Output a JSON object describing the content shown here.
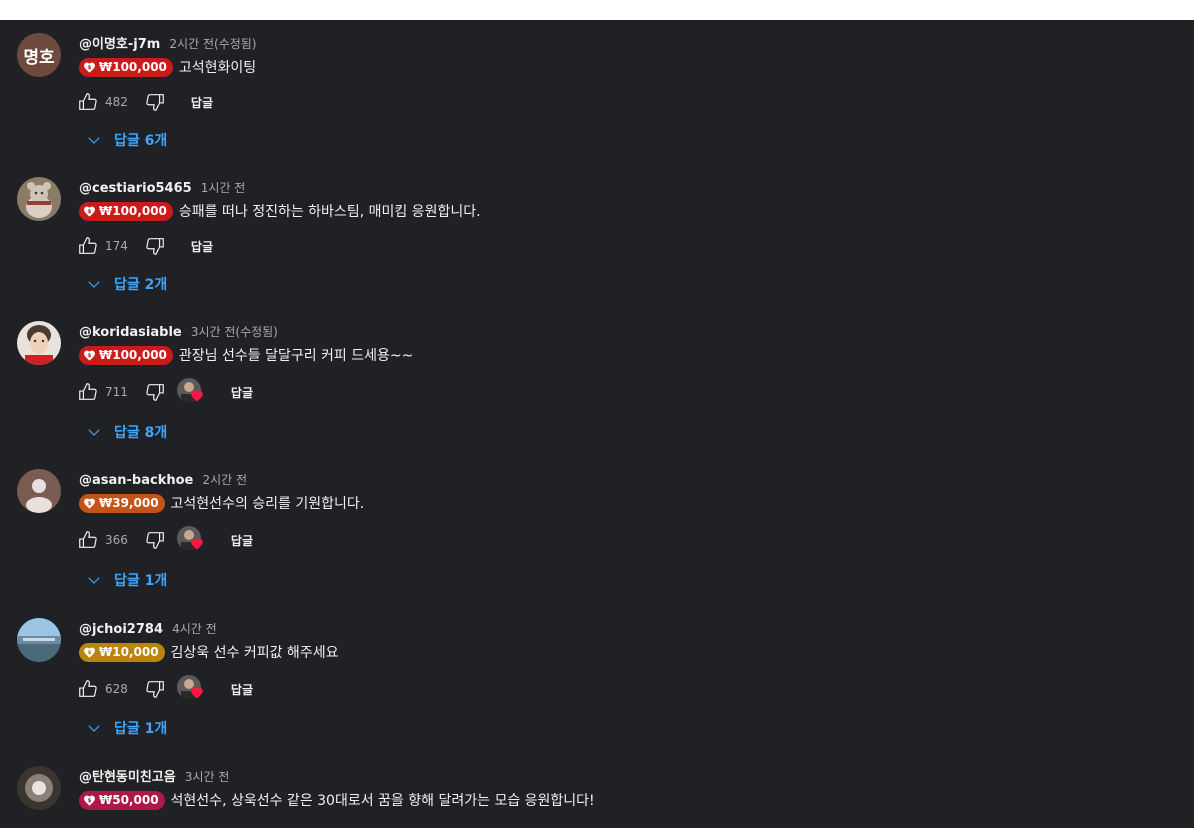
{
  "colors": {
    "background": "#202124",
    "text_primary": "#f1f1f1",
    "text_secondary": "#aaaaaa",
    "link_blue": "#3ea6ff",
    "heart_red": "#ff1744"
  },
  "icons": {
    "like": "thumbs-up-icon",
    "dislike": "thumbs-down-icon",
    "expand": "chevron-down-icon",
    "super_thanks": "money-heart-icon",
    "creator_heart": "heart-icon"
  },
  "comments": [
    {
      "author": "@이명호-j7m",
      "time": "2시간 전(수정됨)",
      "avatar_text": "명호",
      "amount": "₩100,000",
      "amount_color": "#cc1a1a",
      "text": "고석현화이팅",
      "likes": "482",
      "hearted": false,
      "reply_label": "답글",
      "replies_label": "답글 6개"
    },
    {
      "author": "@cestiario5465",
      "time": "1시간 전",
      "avatar_text": "",
      "amount": "₩100,000",
      "amount_color": "#cc1a1a",
      "text": "승패를 떠나 정진하는 하바스팀, 매미킴 응원합니다.",
      "likes": "174",
      "hearted": false,
      "reply_label": "답글",
      "replies_label": "답글 2개"
    },
    {
      "author": "@koridasiable",
      "time": "3시간 전(수정됨)",
      "avatar_text": "",
      "amount": "₩100,000",
      "amount_color": "#cc1a1a",
      "text": "관장님 선수들 달달구리 커피 드세용~~",
      "likes": "711",
      "hearted": true,
      "reply_label": "답글",
      "replies_label": "답글 8개"
    },
    {
      "author": "@asan-backhoe",
      "time": "2시간 전",
      "avatar_text": "",
      "amount": "₩39,000",
      "amount_color": "#c4531a",
      "text": "고석현선수의 승리를 기원합니다.",
      "likes": "366",
      "hearted": true,
      "reply_label": "답글",
      "replies_label": "답글 1개"
    },
    {
      "author": "@jchoi2784",
      "time": "4시간 전",
      "avatar_text": "",
      "amount": "₩10,000",
      "amount_color": "#b8860b",
      "text": "김상욱 선수 커피값 해주세요",
      "likes": "628",
      "hearted": true,
      "reply_label": "답글",
      "replies_label": "답글 1개"
    },
    {
      "author": "@탄현동미친고음",
      "time": "3시간 전",
      "avatar_text": "",
      "amount": "₩50,000",
      "amount_color": "#b0184a",
      "text": "석현선수, 상욱선수 같은 30대로서 꿈을 향해 달려가는 모습 응원합니다!",
      "likes": "",
      "hearted": false,
      "reply_label": "",
      "replies_label": ""
    }
  ]
}
